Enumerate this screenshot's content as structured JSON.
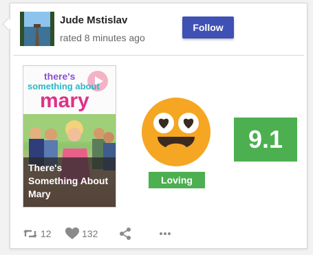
{
  "user": {
    "name": "Jude Mstislav",
    "activity": "rated 8 minutes ago",
    "avatar_icon": "pier-lake-photo"
  },
  "follow_label": "Follow",
  "movie": {
    "poster_art_lines": [
      "there's",
      "something about",
      "mary"
    ],
    "caption": "There's Something About Mary"
  },
  "reaction": {
    "label": "Loving",
    "icon": "heart-eyes-emoji",
    "color": "#4caf50"
  },
  "score": "9.1",
  "actions": {
    "reshare_count": "12",
    "like_count": "132",
    "share_icon": "share-icon",
    "more_icon": "more-icon"
  },
  "colors": {
    "accent": "#3f51b5",
    "positive": "#4caf50",
    "emoji": "#f5a623"
  }
}
